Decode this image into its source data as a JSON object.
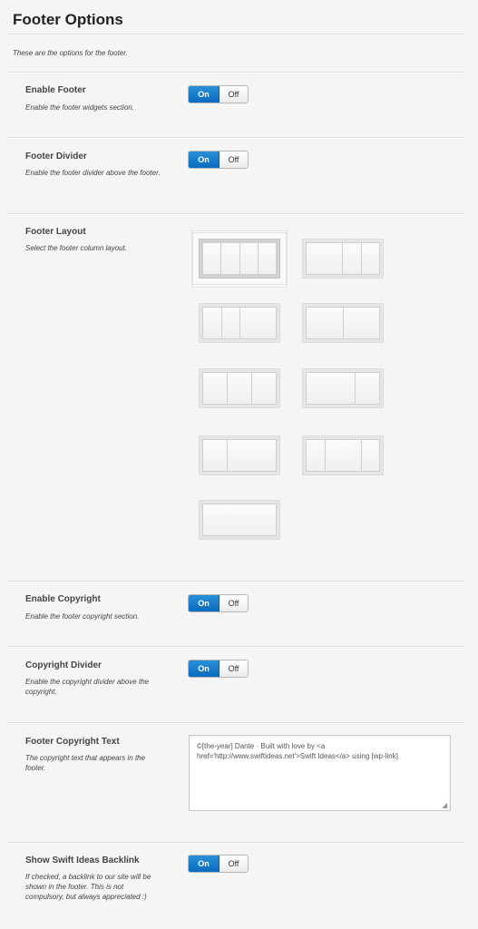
{
  "page": {
    "title": "Footer Options",
    "description": "These are the options for the footer."
  },
  "options": {
    "enable_footer": {
      "label": "Enable Footer",
      "description": "Enable the footer widgets section.",
      "on_label": "On",
      "off_label": "Off",
      "value": "On"
    },
    "footer_divider": {
      "label": "Footer Divider",
      "description": "Enable the footer divider above the footer.",
      "on_label": "On",
      "off_label": "Off",
      "value": "On"
    },
    "footer_layout": {
      "label": "Footer Layout",
      "description": "Select the footer column layout.",
      "selected_index": 0,
      "layouts": [
        {
          "columns": [
            1,
            1,
            1,
            1
          ]
        },
        {
          "columns": [
            2,
            1,
            1
          ]
        },
        {
          "columns": [
            1,
            1,
            2
          ]
        },
        {
          "columns": [
            1,
            1
          ]
        },
        {
          "columns": [
            1,
            1,
            1
          ]
        },
        {
          "columns": [
            2,
            1
          ]
        },
        {
          "columns": [
            1,
            2
          ]
        },
        {
          "columns": [
            1,
            2,
            1
          ]
        },
        {
          "columns": [
            1
          ]
        }
      ]
    },
    "enable_copyright": {
      "label": "Enable Copyright",
      "description": "Enable the footer copyright section.",
      "on_label": "On",
      "off_label": "Off",
      "value": "On"
    },
    "copyright_divider": {
      "label": "Copyright Divider",
      "description": "Enable the copyright divider above the copyright.",
      "on_label": "On",
      "off_label": "Off",
      "value": "On"
    },
    "copyright_text": {
      "label": "Footer Copyright Text",
      "description": "The copyright text that appears in the footer.",
      "value": "©[the-year] Dante · Built with love by <a href='http://www.swiftideas.net'>Swift Ideas</a> using [wp-link]."
    },
    "swift_backlink": {
      "label": "Show Swift Ideas Backlink",
      "description": "If checked, a backlink to our site will be shown in the footer. This is not compulsory, but always appreciated :)",
      "on_label": "On",
      "off_label": "Off",
      "value": "On"
    }
  },
  "colors": {
    "toggle_on": "#0b6bbf",
    "background": "#f5f5f5"
  }
}
